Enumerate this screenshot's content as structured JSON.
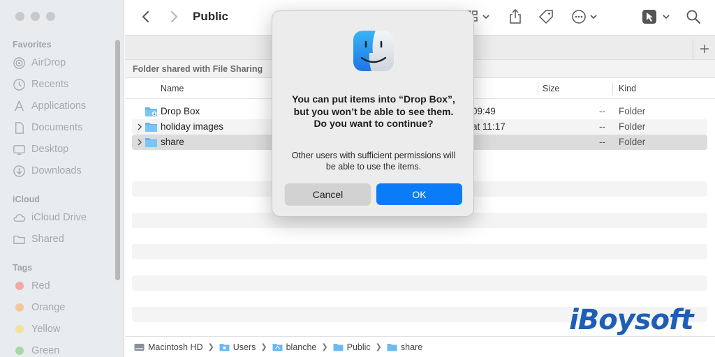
{
  "window": {
    "title": "Public"
  },
  "sidebar": {
    "favorites_label": "Favorites",
    "favorites": [
      {
        "label": "AirDrop",
        "icon": "airdrop-icon"
      },
      {
        "label": "Recents",
        "icon": "clock-icon"
      },
      {
        "label": "Applications",
        "icon": "applications-icon"
      },
      {
        "label": "Documents",
        "icon": "document-icon"
      },
      {
        "label": "Desktop",
        "icon": "desktop-icon"
      },
      {
        "label": "Downloads",
        "icon": "download-icon"
      }
    ],
    "icloud_label": "iCloud",
    "icloud": [
      {
        "label": "iCloud Drive",
        "icon": "cloud-icon"
      },
      {
        "label": "Shared",
        "icon": "shared-folder-icon"
      }
    ],
    "tags_label": "Tags",
    "tags": [
      {
        "label": "Red",
        "color": "#f2a8a6"
      },
      {
        "label": "Orange",
        "color": "#f5c59a"
      },
      {
        "label": "Yellow",
        "color": "#f4e09a"
      },
      {
        "label": "Green",
        "color": "#a8d9a4"
      }
    ]
  },
  "banner": {
    "text": "Folder shared with File Sharing"
  },
  "columns": {
    "name": "Name",
    "size": "Size",
    "kind": "Kind"
  },
  "files": [
    {
      "name": "Drop Box",
      "date": "09:49",
      "size": "--",
      "kind": "Folder"
    },
    {
      "name": "holiday images",
      "date": "at 11:17",
      "size": "--",
      "kind": "Folder"
    },
    {
      "name": "share",
      "date": "",
      "size": "--",
      "kind": "Folder"
    }
  ],
  "path": [
    "Macintosh HD",
    "Users",
    "blanche",
    "Public",
    "share"
  ],
  "dialog": {
    "title": "You can put items into “Drop Box”, but you won’t be able to see them. Do you want to continue?",
    "message": "Other users with sufficient permissions will be able to use the items.",
    "cancel_label": "Cancel",
    "ok_label": "OK"
  },
  "watermark": {
    "text": "iBoysoft"
  },
  "colors": {
    "accent": "#0a7cf8",
    "watermark": "#1e5fb5"
  }
}
